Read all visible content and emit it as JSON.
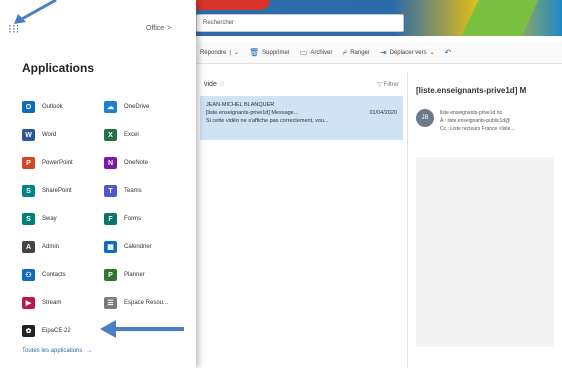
{
  "header": {
    "search_text": "Rechercher"
  },
  "ribbon": {
    "items": [
      {
        "label": "Répondre",
        "icon": "reply-icon"
      },
      {
        "label": "Supprimer",
        "icon": "trash-icon"
      },
      {
        "label": "Archiver",
        "icon": "archive-icon"
      },
      {
        "label": "Ranger",
        "icon": "broom-icon"
      },
      {
        "label": "Déplacer vers",
        "icon": "move-icon"
      }
    ],
    "separator": "|",
    "dropdown": "⌄",
    "undo": "↶"
  },
  "list": {
    "title": "vide",
    "filter_label": "Filtrer",
    "selected_mail": {
      "sender": "JEAN-MICHEL BLANQUER",
      "subject": "[liste.enseignants-prive1d] Message...",
      "date": "01/04/2020",
      "preview": "Si cette vidéo ne s'affiche pas correctement, vou..."
    }
  },
  "reading": {
    "subject": "[liste.enseignants-prive1d] M",
    "avatar_initials": "JB",
    "line1": "liste.enseignants-prive1d no",
    "line2": "À : liste.enseignants-public1d@",
    "line3": "Cc : Liste recteurs France <liste..."
  },
  "panel": {
    "office_label": "Office",
    "office_chevron": ">",
    "title": "Applications",
    "all_apps_label": "Toutes les applications",
    "all_apps_chevron": "→",
    "apps": [
      {
        "label": "Outlook",
        "icon": "outlook-icon",
        "color": "#0f6cbd",
        "glyph": "O"
      },
      {
        "label": "OneDrive",
        "icon": "onedrive-icon",
        "color": "#1e7fd4",
        "glyph": "☁"
      },
      {
        "label": "Word",
        "icon": "word-icon",
        "color": "#2b579a",
        "glyph": "W"
      },
      {
        "label": "Excel",
        "icon": "excel-icon",
        "color": "#217346",
        "glyph": "X"
      },
      {
        "label": "PowerPoint",
        "icon": "powerpoint-icon",
        "color": "#d24726",
        "glyph": "P"
      },
      {
        "label": "OneNote",
        "icon": "onenote-icon",
        "color": "#7719aa",
        "glyph": "N"
      },
      {
        "label": "SharePoint",
        "icon": "sharepoint-icon",
        "color": "#038387",
        "glyph": "S"
      },
      {
        "label": "Teams",
        "icon": "teams-icon",
        "color": "#5059c9",
        "glyph": "T"
      },
      {
        "label": "Sway",
        "icon": "sway-icon",
        "color": "#008272",
        "glyph": "S"
      },
      {
        "label": "Forms",
        "icon": "forms-icon",
        "color": "#077568",
        "glyph": "F"
      },
      {
        "label": "Admin",
        "icon": "admin-icon",
        "color": "#444444",
        "glyph": "A"
      },
      {
        "label": "Calendrier",
        "icon": "calendar-icon",
        "color": "#0f6cbd",
        "glyph": "▦"
      },
      {
        "label": "Contacts",
        "icon": "contacts-icon",
        "color": "#0f6cbd",
        "glyph": "⚇"
      },
      {
        "label": "Planner",
        "icon": "planner-icon",
        "color": "#31752f",
        "glyph": "P"
      },
      {
        "label": "Stream",
        "icon": "stream-icon",
        "color": "#bc1948",
        "glyph": "▶"
      },
      {
        "label": "Espace Resou...",
        "icon": "resources-icon",
        "color": "#7a7a7a",
        "glyph": "☰"
      },
      {
        "label": "EipaCE 22",
        "icon": "eipace-icon",
        "color": "#222222",
        "glyph": "✿"
      }
    ]
  }
}
